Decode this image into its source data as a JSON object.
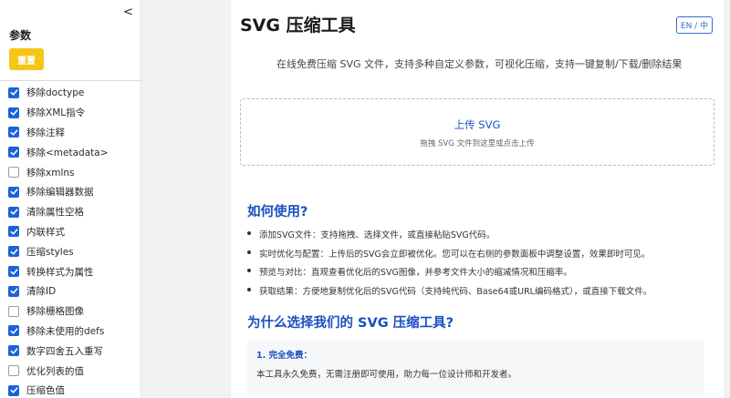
{
  "sidebar": {
    "collapse_glyph": "<",
    "title": "参数",
    "reset_label": "重置",
    "options": [
      {
        "label": "移除doctype",
        "checked": true
      },
      {
        "label": "移除XML指令",
        "checked": true
      },
      {
        "label": "移除注释",
        "checked": true
      },
      {
        "label": "移除<metadata>",
        "checked": true
      },
      {
        "label": "移除xmlns",
        "checked": false
      },
      {
        "label": "移除编辑器数据",
        "checked": true
      },
      {
        "label": "清除属性空格",
        "checked": true
      },
      {
        "label": "内联样式",
        "checked": true
      },
      {
        "label": "压缩styles",
        "checked": true
      },
      {
        "label": "转换样式为属性",
        "checked": true
      },
      {
        "label": "清除ID",
        "checked": true
      },
      {
        "label": "移除栅格图像",
        "checked": false
      },
      {
        "label": "移除未使用的defs",
        "checked": true
      },
      {
        "label": "数字四舍五入重写",
        "checked": true
      },
      {
        "label": "优化列表的值",
        "checked": false
      },
      {
        "label": "压缩色值",
        "checked": true
      }
    ]
  },
  "header": {
    "title": "SVG 压缩工具",
    "lang_label": "EN / 中"
  },
  "subtitle": "在线免费压缩 SVG 文件，支持多种自定义参数，可视化压缩，支持一键复制/下载/删除结果",
  "upload": {
    "title": "上传 SVG",
    "hint": "拖拽 SVG 文件到这里或点击上传"
  },
  "howto": {
    "heading": "如何使用?",
    "steps": [
      "添加SVG文件：支持拖拽、选择文件，或直接粘贴SVG代码。",
      "实时优化与配置：上传后的SVG会立即被优化。您可以在右侧的参数面板中调整设置，效果即时可见。",
      "预览与对比：直观查看优化后的SVG图像，并参考文件大小的缩减情况和压缩率。",
      "获取结果：方便地复制优化后的SVG代码（支持纯代码、Base64或URL编码格式），或直接下载文件。"
    ]
  },
  "why": {
    "heading": "为什么选择我们的 SVG 压缩工具?",
    "items": [
      {
        "title": "1. 完全免费：",
        "text": "本工具永久免费，无需注册即可使用，助力每一位设计师和开发者。"
      }
    ]
  },
  "colors": {
    "accent": "#1a4fc0",
    "checkbox": "#1a63d8",
    "reset_button": "#f5c518"
  }
}
